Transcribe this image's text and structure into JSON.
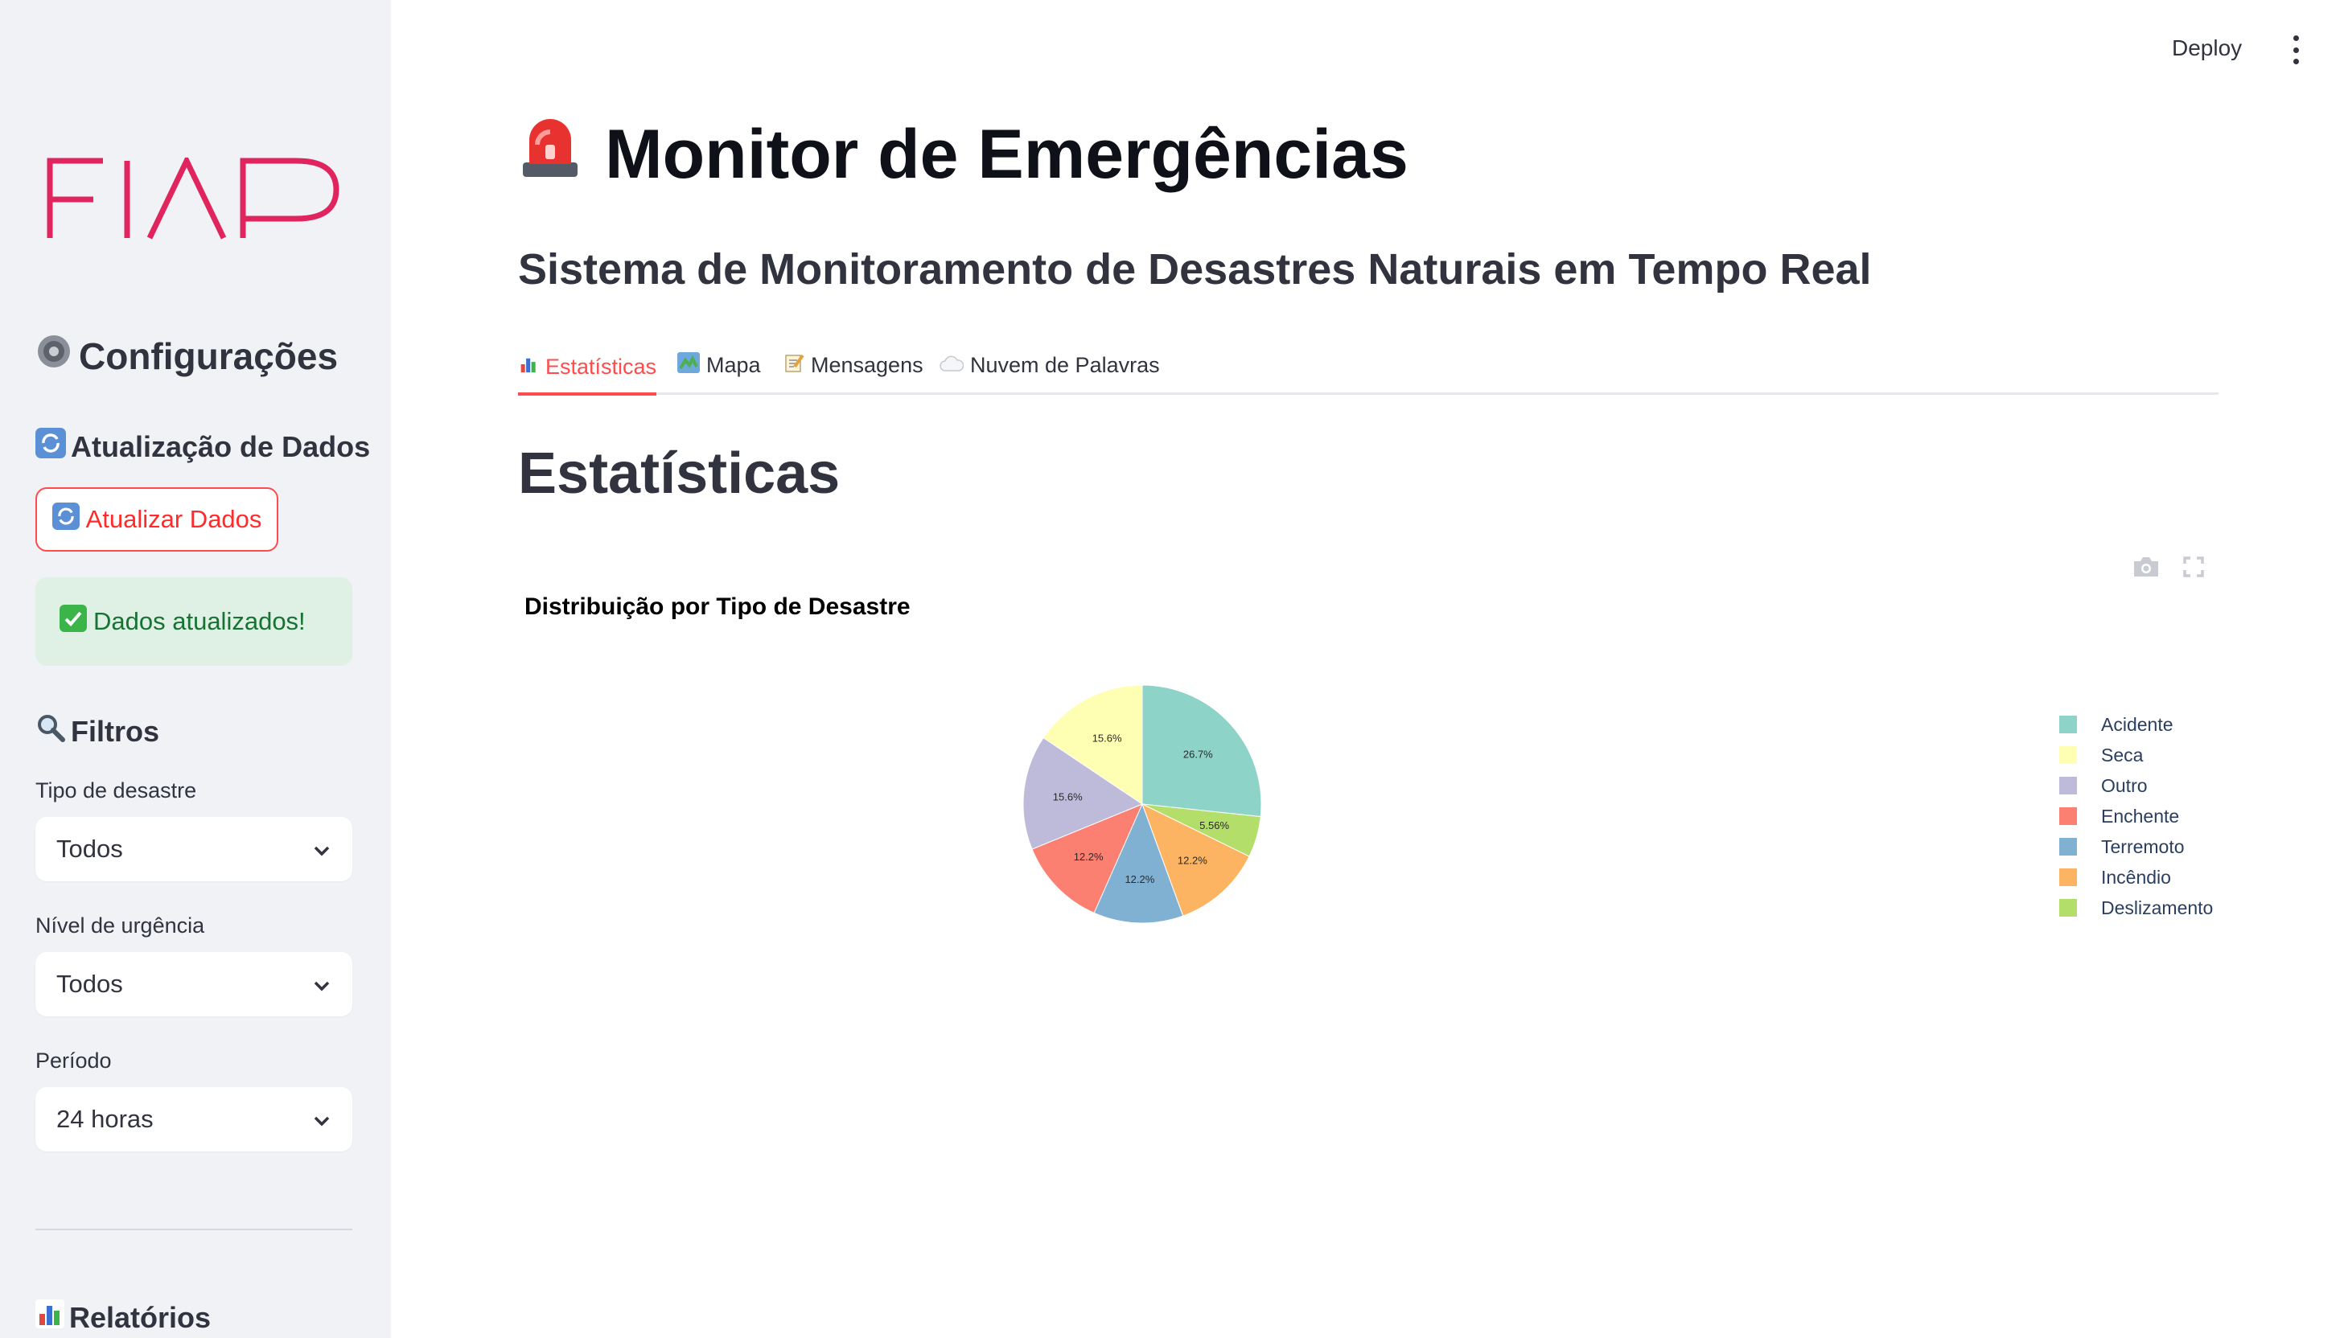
{
  "sidebar": {
    "logo_text": "FIAP",
    "config_title": "Configurações",
    "update_section_title": "Atualização de Dados",
    "update_button_label": "Atualizar Dados",
    "success_message": "Dados atualizados!",
    "filters_title": "Filtros",
    "filters": [
      {
        "label": "Tipo de desastre",
        "value": "Todos"
      },
      {
        "label": "Nível de urgência",
        "value": "Todos"
      },
      {
        "label": "Período",
        "value": "24 horas"
      }
    ],
    "reports_title": "Relatórios"
  },
  "header": {
    "deploy_label": "Deploy"
  },
  "main": {
    "title": "Monitor de Emergências",
    "subtitle": "Sistema de Monitoramento de Desastres Naturais em Tempo Real",
    "tabs": [
      {
        "label": "Estatísticas",
        "active": true
      },
      {
        "label": "Mapa",
        "active": false
      },
      {
        "label": "Mensagens",
        "active": false
      },
      {
        "label": "Nuvem de Palavras",
        "active": false
      }
    ],
    "section_title": "Estatísticas"
  },
  "colors": {
    "accent": "#ff4b4b",
    "sidebar_bg": "#f0f2f6",
    "success_bg": "#dff0e4",
    "success_text": "#177233",
    "logo": "#e0245e"
  },
  "icons": {
    "title": "rotating-light-icon",
    "config": "gear-icon",
    "update": "refresh-icon",
    "success": "check-mark-icon",
    "filters": "magnifier-icon",
    "reports": "bar-chart-icon",
    "tab_stats": "bar-chart-icon",
    "tab_map": "map-icon",
    "tab_messages": "memo-icon",
    "tab_cloud": "cloud-icon"
  },
  "chart_data": {
    "type": "pie",
    "title": "Distribuição por Tipo de Desastre",
    "legend_position": "right",
    "slices": [
      {
        "label": "Acidente",
        "value": 26.7,
        "text": "26.7%",
        "color": "#8dd3c7"
      },
      {
        "label": "Deslizamento",
        "value": 5.56,
        "text": "5.56%",
        "color": "#b3de69"
      },
      {
        "label": "Incêndio",
        "value": 12.2,
        "text": "12.2%",
        "color": "#fdb462"
      },
      {
        "label": "Terremoto",
        "value": 12.2,
        "text": "12.2%",
        "color": "#80b1d3"
      },
      {
        "label": "Enchente",
        "value": 12.2,
        "text": "12.2%",
        "color": "#fb8072"
      },
      {
        "label": "Outro",
        "value": 15.6,
        "text": "15.6%",
        "color": "#bebada"
      },
      {
        "label": "Seca",
        "value": 15.6,
        "text": "15.6%",
        "color": "#ffffb3"
      }
    ],
    "legend": [
      "Acidente",
      "Seca",
      "Outro",
      "Enchente",
      "Terremoto",
      "Incêndio",
      "Deslizamento"
    ]
  }
}
